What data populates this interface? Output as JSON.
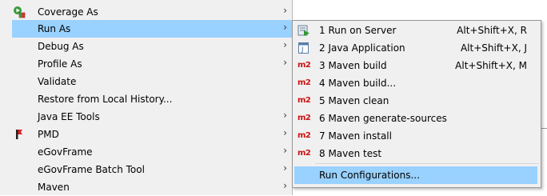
{
  "context_menu": {
    "items": [
      {
        "label": "Coverage As",
        "icon": "coverage-icon",
        "has_submenu": true
      },
      {
        "label": "Run As",
        "icon": "",
        "has_submenu": true
      },
      {
        "label": "Debug As",
        "icon": "",
        "has_submenu": true
      },
      {
        "label": "Profile As",
        "icon": "",
        "has_submenu": true
      },
      {
        "label": "Validate",
        "icon": "",
        "has_submenu": false
      },
      {
        "label": "Restore from Local History...",
        "icon": "",
        "has_submenu": false
      },
      {
        "label": "Java EE Tools",
        "icon": "",
        "has_submenu": true
      },
      {
        "label": "PMD",
        "icon": "pmd-icon",
        "has_submenu": true
      },
      {
        "label": "eGovFrame",
        "icon": "",
        "has_submenu": true
      },
      {
        "label": "eGovFrame Batch Tool",
        "icon": "",
        "has_submenu": true
      },
      {
        "label": "Maven",
        "icon": "",
        "has_submenu": true
      }
    ],
    "arrow_glyph": "›"
  },
  "run_as_submenu": {
    "items": [
      {
        "label": "1 Run on Server",
        "shortcut": "Alt+Shift+X, R",
        "icon": "server-run-icon"
      },
      {
        "label": "2 Java Application",
        "shortcut": "Alt+Shift+X, J",
        "icon": "java-app-icon"
      },
      {
        "label": "3 Maven build",
        "shortcut": "Alt+Shift+X, M",
        "icon": "maven-icon"
      },
      {
        "label": "4 Maven build...",
        "shortcut": "",
        "icon": "maven-icon"
      },
      {
        "label": "5 Maven clean",
        "shortcut": "",
        "icon": "maven-icon"
      },
      {
        "label": "6 Maven generate-sources",
        "shortcut": "",
        "icon": "maven-icon"
      },
      {
        "label": "7 Maven install",
        "shortcut": "",
        "icon": "maven-icon"
      },
      {
        "label": "8 Maven test",
        "shortcut": "",
        "icon": "maven-icon"
      }
    ],
    "footer_item": {
      "label": "Run Configurations..."
    },
    "maven_icon_text": "m2"
  },
  "colors": {
    "menu_bg": "#f0f0f0",
    "highlight": "#99d1ff",
    "maven_red": "#cc1111"
  }
}
